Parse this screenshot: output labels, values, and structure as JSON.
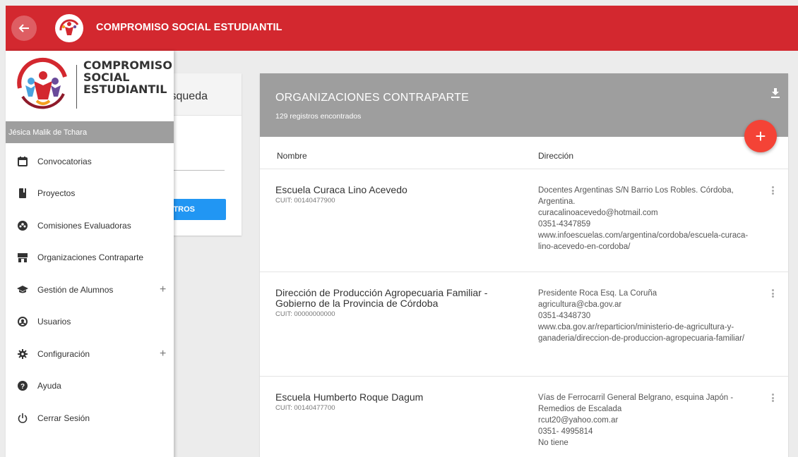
{
  "appbar": {
    "title": "COMPROMISO SOCIAL ESTUDIANTIL"
  },
  "drawer": {
    "brand_line1": "COMPROMISO",
    "brand_line2": "SOCIAL",
    "brand_line3": "ESTUDIANTIL",
    "user_name": "Jésica Malik de Tchara",
    "items": [
      {
        "label": "Convocatorias",
        "icon": "calendar-icon"
      },
      {
        "label": "Proyectos",
        "icon": "bookmark-icon"
      },
      {
        "label": "Comisiones Evaluadoras",
        "icon": "group-icon"
      },
      {
        "label": "Organizaciones Contraparte",
        "icon": "store-icon"
      },
      {
        "label": "Gestión de Alumnos",
        "icon": "graduation-cap-icon",
        "expand": "+"
      },
      {
        "label": "Usuarios",
        "icon": "user-circle-icon"
      },
      {
        "label": "Configuración",
        "icon": "gear-icon",
        "expand": "+"
      },
      {
        "label": "Ayuda",
        "icon": "help-icon"
      },
      {
        "label": "Cerrar Sesión",
        "icon": "power-icon"
      }
    ]
  },
  "search": {
    "title": "isqueda",
    "button_label": "TROS"
  },
  "main": {
    "title": "ORGANIZACIONES CONTRAPARTE",
    "count": "129 registros encontrados",
    "fab": "+",
    "columns": {
      "nombre": "Nombre",
      "direccion": "Dirección"
    },
    "rows": [
      {
        "name": "Escuela Curaca Lino Acevedo",
        "cuit": "CUIT: 00140477900",
        "address": [
          "Docentes Argentinas S/N Barrio Los Robles. Córdoba, Argentina.",
          "curacalinoacevedo@hotmail.com",
          "0351-4347859",
          "www.infoescuelas.com/argentina/cordoba/escuela-curaca-lino-acevedo-en-cordoba/"
        ]
      },
      {
        "name": "Dirección de Producción Agropecuaria Familiar - Gobierno de la Provincia de Córdoba",
        "cuit": "CUIT: 00000000000",
        "address": [
          "Presidente Roca Esq. La Coruña",
          "agricultura@cba.gov.ar",
          "0351-4348730",
          "www.cba.gov.ar/reparticion/ministerio-de-agricultura-y-ganaderia/direccion-de-produccion-agropecuaria-familiar/"
        ]
      },
      {
        "name": "Escuela Humberto Roque Dagum",
        "cuit": "CUIT: 00140477700",
        "address": [
          "Vías de Ferrocarril General Belgrano, esquina Japón - Remedios de Escalada",
          "rcut20@yahoo.com.ar",
          "0351- 4995814",
          "No tiene"
        ]
      }
    ]
  },
  "colors": {
    "appbar": "#d3282f",
    "header_gray": "#9e9e9e",
    "fab": "#f44336",
    "button_blue": "#2196f3"
  }
}
